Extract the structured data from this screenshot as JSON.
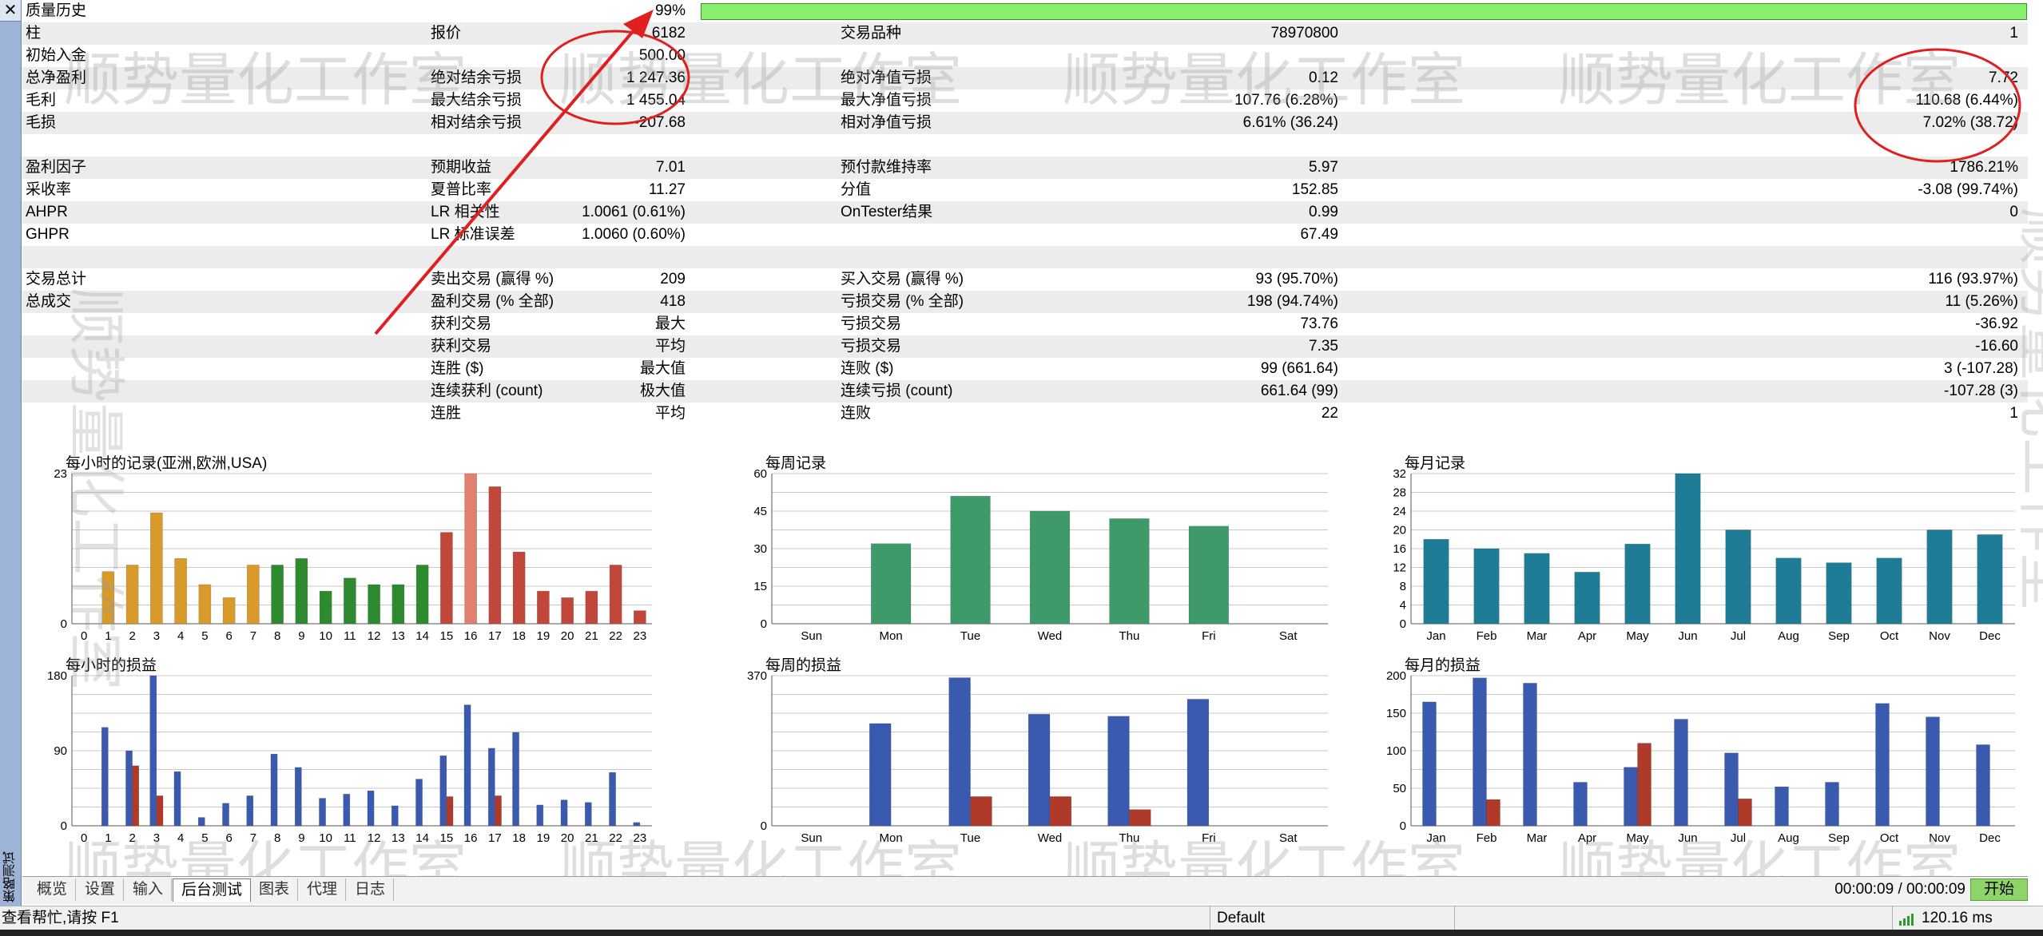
{
  "sidebar": {
    "close_glyph": "✕",
    "vertical_label": "策略测试"
  },
  "stats": {
    "quality_label": "质量历史",
    "quality_value": "99%",
    "rows": [
      {
        "c": [
          [
            "柱",
            "6182"
          ],
          [
            "报价",
            "78970800"
          ],
          [
            "交易品种",
            "1"
          ]
        ]
      },
      {
        "c": [
          [
            "初始入金",
            "500.00"
          ],
          [
            "",
            ""
          ],
          [
            "",
            ""
          ]
        ]
      },
      {
        "c": [
          [
            "总净盈利",
            "1 247.36"
          ],
          [
            "绝对结余亏损",
            "0.12"
          ],
          [
            "绝对净值亏损",
            "7.72"
          ]
        ]
      },
      {
        "c": [
          [
            "毛利",
            "1 455.04"
          ],
          [
            "最大结余亏损",
            "107.76 (6.28%)"
          ],
          [
            "最大净值亏损",
            "110.68 (6.44%)"
          ]
        ]
      },
      {
        "c": [
          [
            "毛损",
            "-207.68"
          ],
          [
            "相对结余亏损",
            "6.61% (36.24)"
          ],
          [
            "相对净值亏损",
            "7.02% (38.72)"
          ]
        ]
      },
      {
        "c": [
          [
            "",
            ""
          ],
          [
            "",
            ""
          ],
          [
            "",
            ""
          ]
        ]
      },
      {
        "c": [
          [
            "盈利因子",
            "7.01"
          ],
          [
            "预期收益",
            "5.97"
          ],
          [
            "预付款维持率",
            "1786.21%"
          ]
        ]
      },
      {
        "c": [
          [
            "采收率",
            "11.27"
          ],
          [
            "夏普比率",
            "152.85"
          ],
          [
            "分值",
            "-3.08 (99.74%)"
          ]
        ]
      },
      {
        "c": [
          [
            "AHPR",
            "1.0061 (0.61%)"
          ],
          [
            "LR 相关性",
            "0.99"
          ],
          [
            "OnTester结果",
            "0"
          ]
        ]
      },
      {
        "c": [
          [
            "GHPR",
            "1.0060 (0.60%)"
          ],
          [
            "LR 标准误差",
            "67.49"
          ],
          [
            "",
            ""
          ]
        ]
      },
      {
        "c": [
          [
            "",
            ""
          ],
          [
            "",
            ""
          ],
          [
            "",
            ""
          ]
        ]
      },
      {
        "c": [
          [
            "交易总计",
            "209"
          ],
          [
            "卖出交易 (赢得 %)",
            "93 (95.70%)"
          ],
          [
            "买入交易 (赢得 %)",
            "116 (93.97%)"
          ]
        ]
      },
      {
        "c": [
          [
            "总成交",
            "418"
          ],
          [
            "盈利交易 (% 全部)",
            "198 (94.74%)"
          ],
          [
            "亏损交易 (% 全部)",
            "11 (5.26%)"
          ]
        ]
      },
      {
        "c": [
          [
            "",
            "最大"
          ],
          [
            "获利交易",
            "73.76"
          ],
          [
            "亏损交易",
            "-36.92"
          ]
        ]
      },
      {
        "c": [
          [
            "",
            "平均"
          ],
          [
            "获利交易",
            "7.35"
          ],
          [
            "亏损交易",
            "-16.60"
          ]
        ]
      },
      {
        "c": [
          [
            "",
            "最大值"
          ],
          [
            "连胜 ($)",
            "99 (661.64)"
          ],
          [
            "连败 ($)",
            "3 (-107.28)"
          ]
        ]
      },
      {
        "c": [
          [
            "",
            "极大值"
          ],
          [
            "连续获利 (count)",
            "661.64 (99)"
          ],
          [
            "连续亏损 (count)",
            "-107.28 (3)"
          ]
        ]
      },
      {
        "c": [
          [
            "",
            "平均"
          ],
          [
            "连胜",
            "22"
          ],
          [
            "连败",
            "1"
          ]
        ]
      }
    ]
  },
  "watermark_text": "顺势量化工作室",
  "chart_data": [
    {
      "type": "bar",
      "title": "每小时的记录(亚洲,欧洲,USA)",
      "categories": [
        "0",
        "1",
        "2",
        "3",
        "4",
        "5",
        "6",
        "7",
        "8",
        "9",
        "10",
        "11",
        "12",
        "13",
        "14",
        "15",
        "16",
        "17",
        "18",
        "19",
        "20",
        "21",
        "22",
        "23"
      ],
      "values": [
        0,
        8,
        9,
        17,
        10,
        6,
        4,
        9,
        9,
        10,
        5,
        7,
        6,
        6,
        9,
        14,
        23,
        21,
        11,
        5,
        4,
        5,
        9,
        2
      ],
      "yticks": [
        "0",
        "23"
      ],
      "ylim": [
        0,
        23
      ],
      "colors": [
        "#d89a2a",
        "#d89a2a",
        "#d89a2a",
        "#d89a2a",
        "#d89a2a",
        "#d89a2a",
        "#d89a2a",
        "#d89a2a",
        "#2e8a2e",
        "#2e8a2e",
        "#2e8a2e",
        "#2e8a2e",
        "#2e8a2e",
        "#2e8a2e",
        "#2e8a2e",
        "#c0473a",
        "#e08070",
        "#c0473a",
        "#c0473a",
        "#c0473a",
        "#c0473a",
        "#c0473a",
        "#c0473a",
        "#c0473a"
      ]
    },
    {
      "type": "bar",
      "title": "每周记录",
      "categories": [
        "Sun",
        "Mon",
        "Tue",
        "Wed",
        "Thu",
        "Fri",
        "Sat"
      ],
      "values": [
        0,
        32,
        51,
        45,
        42,
        39,
        0
      ],
      "yticks": [
        "0",
        "15",
        "30",
        "45",
        "60"
      ],
      "ylim": [
        0,
        60
      ],
      "color": "#3f9a6a"
    },
    {
      "type": "bar",
      "title": "每月记录",
      "categories": [
        "Jan",
        "Feb",
        "Mar",
        "Apr",
        "May",
        "Jun",
        "Jul",
        "Aug",
        "Sep",
        "Oct",
        "Nov",
        "Dec"
      ],
      "values": [
        18,
        16,
        15,
        11,
        17,
        32,
        20,
        14,
        13,
        14,
        20,
        19
      ],
      "yticks": [
        "0",
        "4",
        "8",
        "12",
        "16",
        "20",
        "24",
        "28",
        "32"
      ],
      "ylim": [
        0,
        32
      ],
      "color": "#1f7c96"
    },
    {
      "type": "bar",
      "title": "每小时的损益",
      "categories": [
        "0",
        "1",
        "2",
        "3",
        "4",
        "5",
        "6",
        "7",
        "8",
        "9",
        "10",
        "11",
        "12",
        "13",
        "14",
        "15",
        "16",
        "17",
        "18",
        "19",
        "20",
        "21",
        "22",
        "23"
      ],
      "series": [
        {
          "values": [
            0,
            118,
            90,
            180,
            65,
            10,
            27,
            36,
            86,
            70,
            33,
            38,
            42,
            24,
            56,
            84,
            145,
            93,
            112,
            25,
            31,
            28,
            64,
            4
          ],
          "color": "#3a5ab0"
        },
        {
          "values": [
            0,
            0,
            72,
            36,
            0,
            0,
            0,
            0,
            0,
            0,
            0,
            0,
            0,
            0,
            0,
            35,
            0,
            36,
            0,
            0,
            0,
            0,
            0,
            0
          ],
          "color": "#b03a2a"
        }
      ],
      "yticks": [
        "0",
        "90",
        "180"
      ],
      "ylim": [
        0,
        180
      ]
    },
    {
      "type": "bar",
      "title": "每周的损益",
      "categories": [
        "Sun",
        "Mon",
        "Tue",
        "Wed",
        "Thu",
        "Fri",
        "Sat"
      ],
      "series": [
        {
          "values": [
            0,
            252,
            365,
            275,
            270,
            312,
            0
          ],
          "color": "#3a5ab0"
        },
        {
          "values": [
            0,
            0,
            72,
            72,
            40,
            0,
            0
          ],
          "color": "#b03a2a"
        }
      ],
      "yticks": [
        "0",
        "370"
      ],
      "ylim": [
        0,
        370
      ]
    },
    {
      "type": "bar",
      "title": "每月的损益",
      "categories": [
        "Jan",
        "Feb",
        "Mar",
        "Apr",
        "May",
        "Jun",
        "Jul",
        "Aug",
        "Sep",
        "Oct",
        "Nov",
        "Dec"
      ],
      "series": [
        {
          "values": [
            165,
            197,
            190,
            58,
            78,
            142,
            97,
            52,
            58,
            163,
            145,
            108
          ],
          "color": "#3a5ab0"
        },
        {
          "values": [
            0,
            35,
            0,
            0,
            110,
            0,
            36,
            0,
            0,
            0,
            0,
            0
          ],
          "color": "#b03a2a"
        }
      ],
      "yticks": [
        "0",
        "50",
        "100",
        "150",
        "200"
      ],
      "ylim": [
        0,
        200
      ]
    }
  ],
  "tabs": [
    "概览",
    "设置",
    "输入",
    "后台测试",
    "图表",
    "代理",
    "日志"
  ],
  "active_tab": 3,
  "timer": "00:00:09 / 00:00:09",
  "start_label": "开始",
  "status": {
    "help": "查看帮忙,请按 F1",
    "profile": "Default",
    "ping": "120.16 ms"
  }
}
